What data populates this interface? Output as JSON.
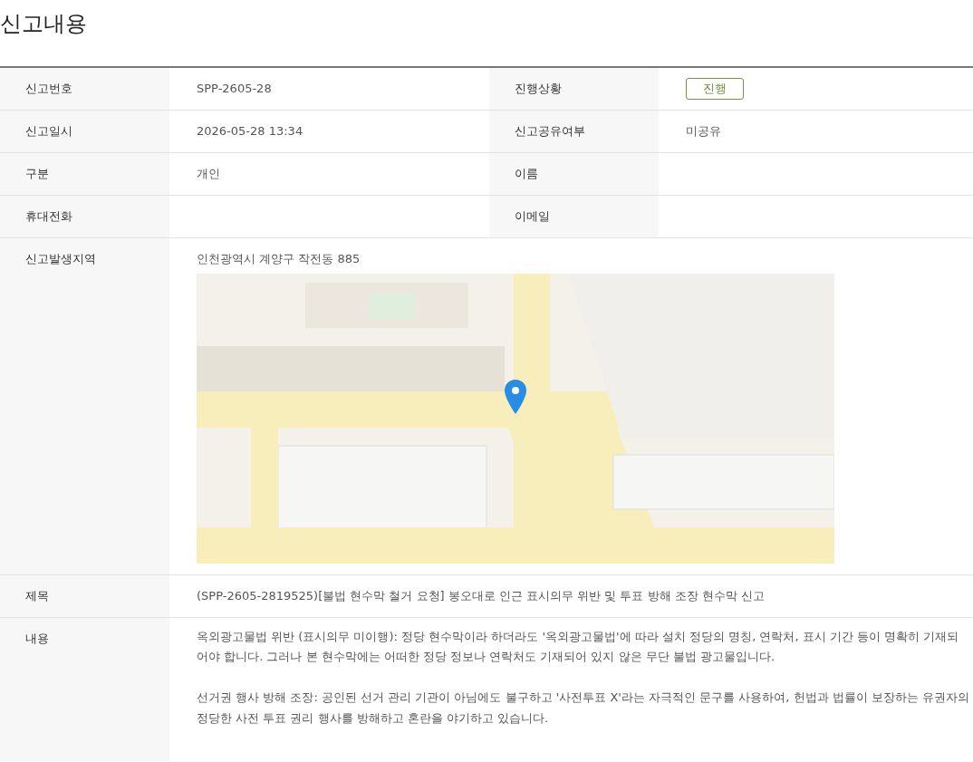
{
  "title": "신고내용",
  "rows": [
    {
      "cells": [
        {
          "label": "신고번호",
          "value": "SPP-2605-28",
          "kind": "text"
        },
        {
          "label": "진행상황",
          "value": "진행",
          "kind": "status"
        }
      ]
    },
    {
      "cells": [
        {
          "label": "신고일시",
          "value": "2026-05-28 13:34",
          "kind": "text"
        },
        {
          "label": "신고공유여부",
          "value": "미공유",
          "kind": "text"
        }
      ]
    },
    {
      "cells": [
        {
          "label": "구분",
          "value": "개인",
          "kind": "text"
        },
        {
          "label": "이름"
        }
      ]
    },
    {
      "cells": [
        {
          "label": "휴대전화"
        },
        {
          "label": "이메일"
        }
      ]
    }
  ],
  "location": {
    "label": "신고발생지역",
    "address": "인천광역시 계양구 작전동 885"
  },
  "subject": {
    "label": "제목",
    "value": "(SPP-2605-2819525)[불법 현수막 철거 요청] 봉오대로 인근 표시의무 위반 및 투표 방해 조장 현수막 신고"
  },
  "content": {
    "label": "내용",
    "paragraphs": [
      "옥외광고물법 위반 (표시의무 미이행): 정당 현수막이라 하더라도 '옥외광고물법'에 따라 설치 정당의 명칭, 연락처, 표시 기간 등이 명확히 기재되어야 합니다. 그러나 본 현수막에는 어떠한 정당 정보나 연락처도 기재되어 있지 않은 무단 불법 광고물입니다.",
      "선거권 행사 방해 조장: 공인된 선거 관리 기관이 아님에도 불구하고 '사전투표 X'라는 자극적인 문구를 사용하여, 헌법과 법률이 보장하는 유권자의 정당한 사전 투표 권리 행사를 방해하고 혼란을 야기하고 있습니다."
    ]
  }
}
